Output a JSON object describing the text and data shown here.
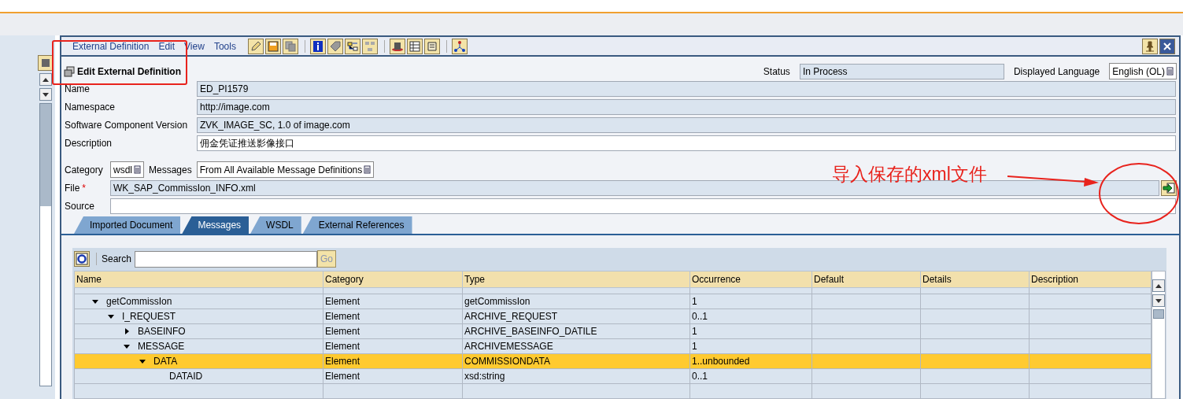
{
  "menu": [
    {
      "label": "External Definition"
    },
    {
      "label": "Edit"
    },
    {
      "label": "View"
    },
    {
      "label": "Tools"
    }
  ],
  "window_title": "Edit External Definition",
  "status": {
    "label": "Status",
    "value": "In Process"
  },
  "language": {
    "label": "Displayed Language",
    "value": "English (OL)"
  },
  "fields": [
    {
      "label": "Name",
      "value": "ED_PI1579",
      "kind": "readonly"
    },
    {
      "label": "Namespace",
      "value": "http://image.com",
      "kind": "readonly"
    },
    {
      "label": "Software Component Version",
      "value": "ZVK_IMAGE_SC, 1.0 of image.com",
      "kind": "readonly"
    },
    {
      "label": "Description",
      "value": "佣金凭证推送影像接口",
      "kind": "input"
    }
  ],
  "category": {
    "label": "Category",
    "value": "wsdl"
  },
  "messages": {
    "label": "Messages",
    "value": "From All Available Message Definitions"
  },
  "file": {
    "label": "File",
    "required": true,
    "required_mark": "*",
    "value": "WK_SAP_CommissIon_INFO.xml"
  },
  "source": {
    "label": "Source"
  },
  "tabs": [
    {
      "label": "Imported Document",
      "selected": false
    },
    {
      "label": "Messages",
      "selected": true
    },
    {
      "label": "WSDL",
      "selected": false
    },
    {
      "label": "External References",
      "selected": false
    }
  ],
  "search": {
    "label": "Search",
    "button": "Go"
  },
  "table": {
    "columns": [
      "Name",
      "Category",
      "Type",
      "Occurrence",
      "Default",
      "Details",
      "Description"
    ],
    "rows": [
      {
        "name": "getCommissIon",
        "category": "Element",
        "type": "getCommissIon",
        "occurrence": "1",
        "kind": "node",
        "expanded": true,
        "selected": false,
        "children": [
          {
            "name": "I_REQUEST",
            "category": "Element",
            "type": "ARCHIVE_REQUEST",
            "occurrence": "0..1",
            "kind": "node",
            "expanded": true,
            "selected": false,
            "children": [
              {
                "name": "BASEINFO",
                "category": "Element",
                "type": "ARCHIVE_BASEINFO_DATILE",
                "occurrence": "1",
                "kind": "node",
                "expanded": false,
                "selected": false
              },
              {
                "name": "MESSAGE",
                "category": "Element",
                "type": "ARCHIVEMESSAGE",
                "occurrence": "1",
                "kind": "node",
                "expanded": true,
                "selected": false,
                "children": [
                  {
                    "name": "DATA",
                    "category": "Element",
                    "type": "COMMISSIONDATA",
                    "occurrence": "1..unbounded",
                    "kind": "node",
                    "expanded": true,
                    "selected": true,
                    "children": [
                      {
                        "name": "DATAID",
                        "category": "Element",
                        "type": "xsd:string",
                        "occurrence": "0..1",
                        "kind": "leaf",
                        "selected": false
                      }
                    ]
                  }
                ]
              }
            ]
          }
        ]
      }
    ]
  },
  "annotation": {
    "text": "导入保存的xml文件"
  }
}
